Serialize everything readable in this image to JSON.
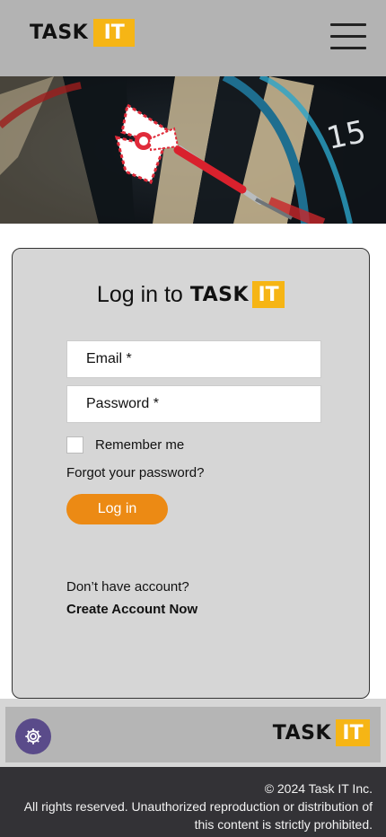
{
  "header": {
    "logo_word": "TASK",
    "logo_box": "IT",
    "menu_icon": "hamburger-menu-icon"
  },
  "hero": {
    "dartboard_number": "15"
  },
  "login": {
    "title_lead": "Log in to",
    "logo_word": "TASK",
    "logo_box": "IT",
    "email_placeholder": "Email *",
    "password_placeholder": "Password *",
    "remember_label": "Remember me",
    "forgot_label": "Forgot your password?",
    "login_button": "Log in",
    "no_account_text": "Don’t have account?",
    "create_account": "Create Account Now"
  },
  "footer": {
    "settings_icon": "gear-icon",
    "logo_word": "TASK",
    "logo_box": "IT"
  },
  "copyright": {
    "line1": "© 2024 Task IT Inc.",
    "line2": "All rights reserved. Unauthorized reproduction or distribution of this content is strictly prohibited."
  },
  "colors": {
    "accent_yellow": "#f6b515",
    "button_orange": "#ec8a14",
    "settings_purple": "#5a4b8a",
    "header_gray": "#b3b3b3",
    "card_gray": "#d6d6d6",
    "copyright_bg": "#333236"
  }
}
